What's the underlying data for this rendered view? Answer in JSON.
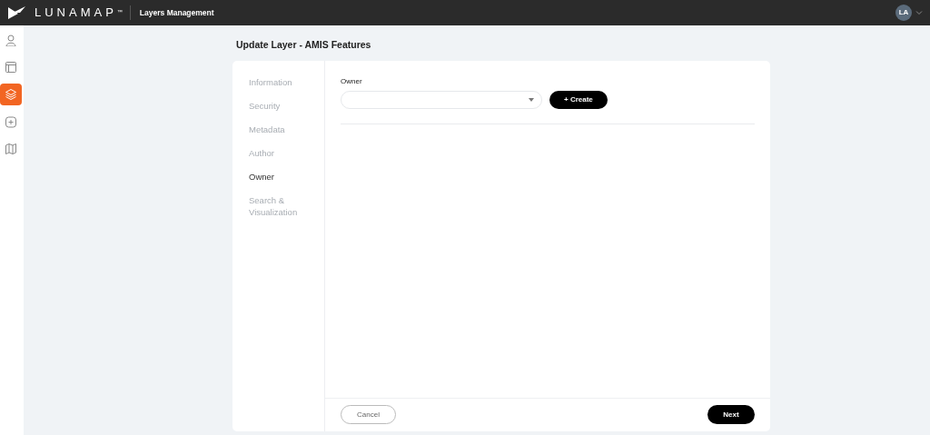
{
  "header": {
    "brand": "LUNAMAP",
    "brand_mark": "™",
    "section": "Layers Management",
    "avatar": "LA"
  },
  "sidebar": {
    "items": [
      {
        "kind": "user",
        "selected": false
      },
      {
        "kind": "layout",
        "selected": false
      },
      {
        "kind": "layers",
        "selected": true
      },
      {
        "kind": "add",
        "selected": false
      },
      {
        "kind": "map",
        "selected": false
      }
    ]
  },
  "page_title": "Update Layer - AMIS Features",
  "steps": [
    {
      "label": "Information",
      "selected": false
    },
    {
      "label": "Security",
      "selected": false
    },
    {
      "label": "Metadata",
      "selected": false
    },
    {
      "label": "Author",
      "selected": false
    },
    {
      "label": "Owner",
      "selected": true
    },
    {
      "label": "Search & Visualization",
      "selected": false
    }
  ],
  "owner": {
    "label": "Owner",
    "create_button": "+ Create"
  },
  "footer": {
    "cancel": "Cancel",
    "next": "Next"
  }
}
